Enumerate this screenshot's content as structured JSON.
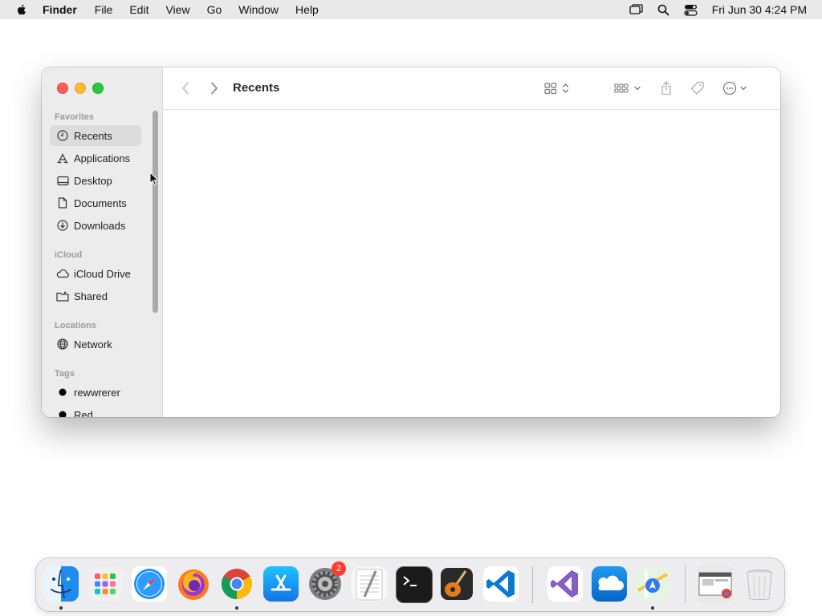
{
  "menubar": {
    "app_name": "Finder",
    "items": [
      "File",
      "Edit",
      "View",
      "Go",
      "Window",
      "Help"
    ],
    "clock": "Fri Jun 30  4:24 PM",
    "status_icons": [
      "screen-mirroring-icon",
      "spotlight-search-icon",
      "control-center-icon"
    ]
  },
  "window": {
    "title": "Recents",
    "traffic_colors": {
      "close": "#fe5f57",
      "minimize": "#febc2e",
      "zoom": "#28c840"
    },
    "sidebar": {
      "favorites_title": "Favorites",
      "favorites": [
        {
          "label": "Recents",
          "icon": "clock-icon",
          "selected": true
        },
        {
          "label": "Applications",
          "icon": "applications-icon"
        },
        {
          "label": "Desktop",
          "icon": "desktop-icon"
        },
        {
          "label": "Documents",
          "icon": "document-icon"
        },
        {
          "label": "Downloads",
          "icon": "download-icon"
        }
      ],
      "icloud_title": "iCloud",
      "icloud": [
        {
          "label": "iCloud Drive",
          "icon": "cloud-icon"
        },
        {
          "label": "Shared",
          "icon": "shared-folder-icon"
        }
      ],
      "locations_title": "Locations",
      "locations": [
        {
          "label": "Network",
          "icon": "globe-icon"
        }
      ],
      "tags_title": "Tags",
      "tags": [
        {
          "label": "rewwrerer",
          "color": "#000000"
        },
        {
          "label": "Red",
          "color": "#000000"
        }
      ]
    },
    "toolbar_icons": [
      "back-icon",
      "forward-icon",
      "icon-view-icon",
      "group-icon",
      "share-icon",
      "tag-icon",
      "more-actions-icon",
      "search-icon"
    ]
  },
  "dock": {
    "apps": [
      {
        "name": "Finder",
        "icon": "finder-icon",
        "running": true
      },
      {
        "name": "Launchpad",
        "icon": "launchpad-icon"
      },
      {
        "name": "Safari",
        "icon": "safari-icon"
      },
      {
        "name": "Firefox",
        "icon": "firefox-icon"
      },
      {
        "name": "Google Chrome",
        "icon": "chrome-icon",
        "running": true
      },
      {
        "name": "App Store",
        "icon": "app-store-icon"
      },
      {
        "name": "System Settings",
        "icon": "settings-icon",
        "badge": "2"
      },
      {
        "name": "TextEdit",
        "icon": "textedit-icon"
      },
      {
        "name": "Terminal",
        "icon": "terminal-icon"
      },
      {
        "name": "GarageBand",
        "icon": "guitar-icon"
      },
      {
        "name": "Visual Studio Code",
        "icon": "vscode-icon"
      },
      {
        "name": "Visual Studio",
        "icon": "visual-studio-icon"
      },
      {
        "name": "OneDrive",
        "icon": "onedrive-icon"
      },
      {
        "name": "Maps",
        "icon": "maps-icon",
        "running": true
      },
      {
        "name": "Chrome Window",
        "icon": "chrome-window-icon"
      },
      {
        "name": "Trash",
        "icon": "trash-icon"
      }
    ]
  }
}
